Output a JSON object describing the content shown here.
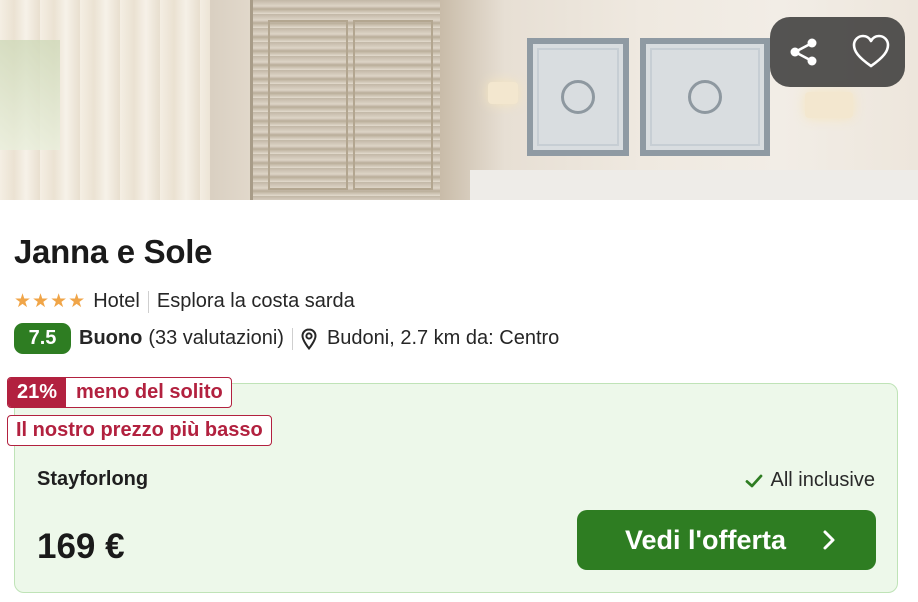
{
  "hero": {
    "actions": {
      "share_icon": "share-icon",
      "favorite_icon": "heart-outline-icon"
    }
  },
  "hotel": {
    "name": "Janna e Sole",
    "stars": 4,
    "type": "Hotel",
    "tagline": "Esplora la costa sarda",
    "rating": {
      "score": "7.5",
      "label": "Buono",
      "count": "(33 valutazioni)"
    },
    "location": "Budoni, 2.7 km da: Centro"
  },
  "offer": {
    "discount_pct": "21%",
    "discount_text": "meno del solito",
    "lowest_price_badge": "Il nostro prezzo più basso",
    "provider": "Stayforlong",
    "board": "All inclusive",
    "price": "169 €",
    "cta_label": "Vedi l'offerta"
  },
  "colors": {
    "brand_green": "#2e7d22",
    "deal_red": "#b2213f",
    "star_orange": "#f0a548",
    "offer_bg": "#edf8ea"
  }
}
